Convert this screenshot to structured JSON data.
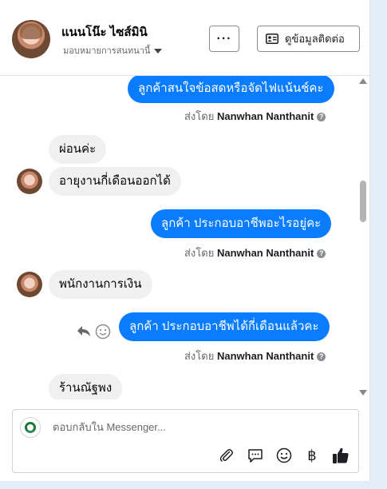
{
  "header": {
    "contact_name": "แนนโน๊ะ ไซส์มินิ",
    "assign_label": "มอบหมายการสนทนานี้",
    "more_label": "···",
    "view_info_label": "ดูข้อมูลติดต่อ"
  },
  "messages": [
    {
      "direction": "out",
      "text": "ลูกค้าสนใจข้อสดหรือจัดไฟแน้นช์คะ",
      "sent_by_prefix": "ส่งโดย",
      "sent_by_name": "Nanwhan Nanthanit"
    },
    {
      "direction": "in",
      "text": "ผ่อนค่ะ"
    },
    {
      "direction": "in",
      "text": "อายุงานกี่เดือนออกได้"
    },
    {
      "direction": "out",
      "text": "ลูกค้า ประกอบอาชีพอะไรอยู่คะ",
      "sent_by_prefix": "ส่งโดย",
      "sent_by_name": "Nanwhan Nanthanit"
    },
    {
      "direction": "in",
      "text": "พนักงานการเงิน"
    },
    {
      "direction": "out",
      "text": "ลูกค้า ประกอบอาชีพได้กี่เดือนแล้วคะ",
      "sent_by_prefix": "ส่งโดย",
      "sent_by_name": "Nanwhan Nanthanit"
    },
    {
      "direction": "in",
      "text": "ร้านณัฐพง"
    }
  ],
  "composer": {
    "placeholder": "ตอบกลับใน Messenger...",
    "tools": [
      "paperclip-icon",
      "saved-reply-icon",
      "emoji-icon",
      "baht-icon",
      "thumbs-up-icon"
    ]
  },
  "colors": {
    "outgoing_bubble": "#0a7cff",
    "incoming_bubble": "#f0f0f0",
    "accent": "#0a7cff"
  }
}
